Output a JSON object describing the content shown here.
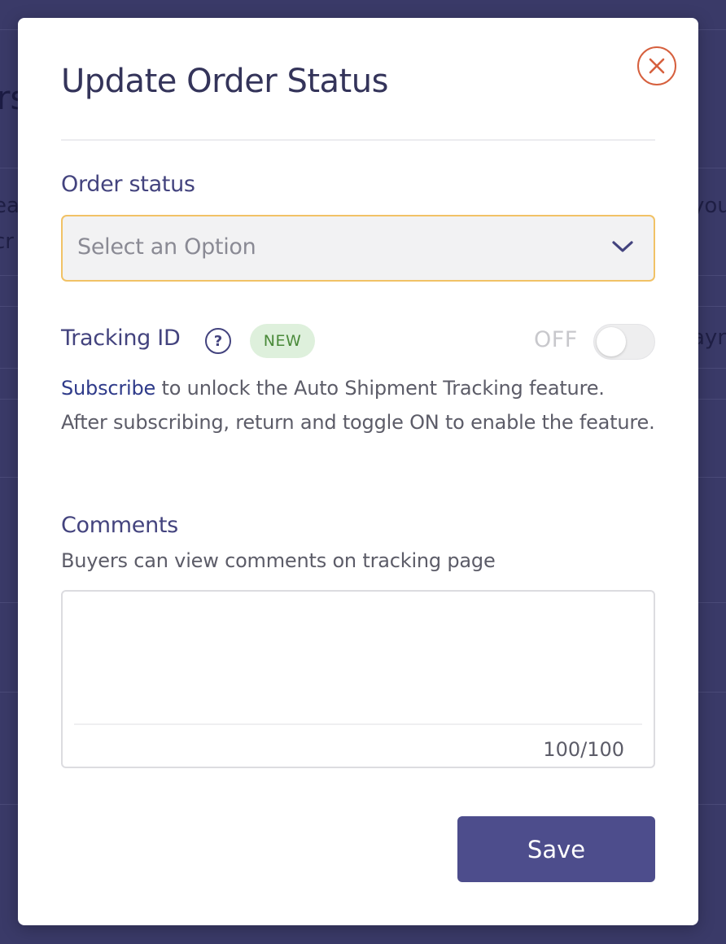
{
  "background": {
    "title_fragment": "rs",
    "text_fragments": [
      "ea",
      "cr",
      "you",
      "ayn"
    ]
  },
  "modal": {
    "title": "Update Order Status",
    "close_icon": "close-circle-icon"
  },
  "order_status": {
    "label": "Order status",
    "placeholder": "Select an Option",
    "chevron_icon": "chevron-down-icon"
  },
  "tracking": {
    "label": "Tracking ID",
    "help_icon": "question-circle-icon",
    "help_glyph": "?",
    "badge": "NEW",
    "toggle_state": "OFF",
    "subscribe_link": "Subscribe",
    "description": " to unlock the Auto Shipment Tracking feature. After subscribing, return and toggle ON to enable the feature."
  },
  "comments": {
    "label": "Comments",
    "hint": "Buyers can view comments on tracking page",
    "value": "",
    "counter": "100/100"
  },
  "actions": {
    "save_label": "Save"
  },
  "colors": {
    "overlay": "#3a3a68",
    "title": "#34345a",
    "label": "#43437e",
    "accent_border": "#f1c266",
    "close": "#d6603e",
    "badge_bg": "#def0dc",
    "badge_text": "#4a8a3a",
    "link": "#2f3b8a",
    "primary_button": "#4d4d8c"
  }
}
